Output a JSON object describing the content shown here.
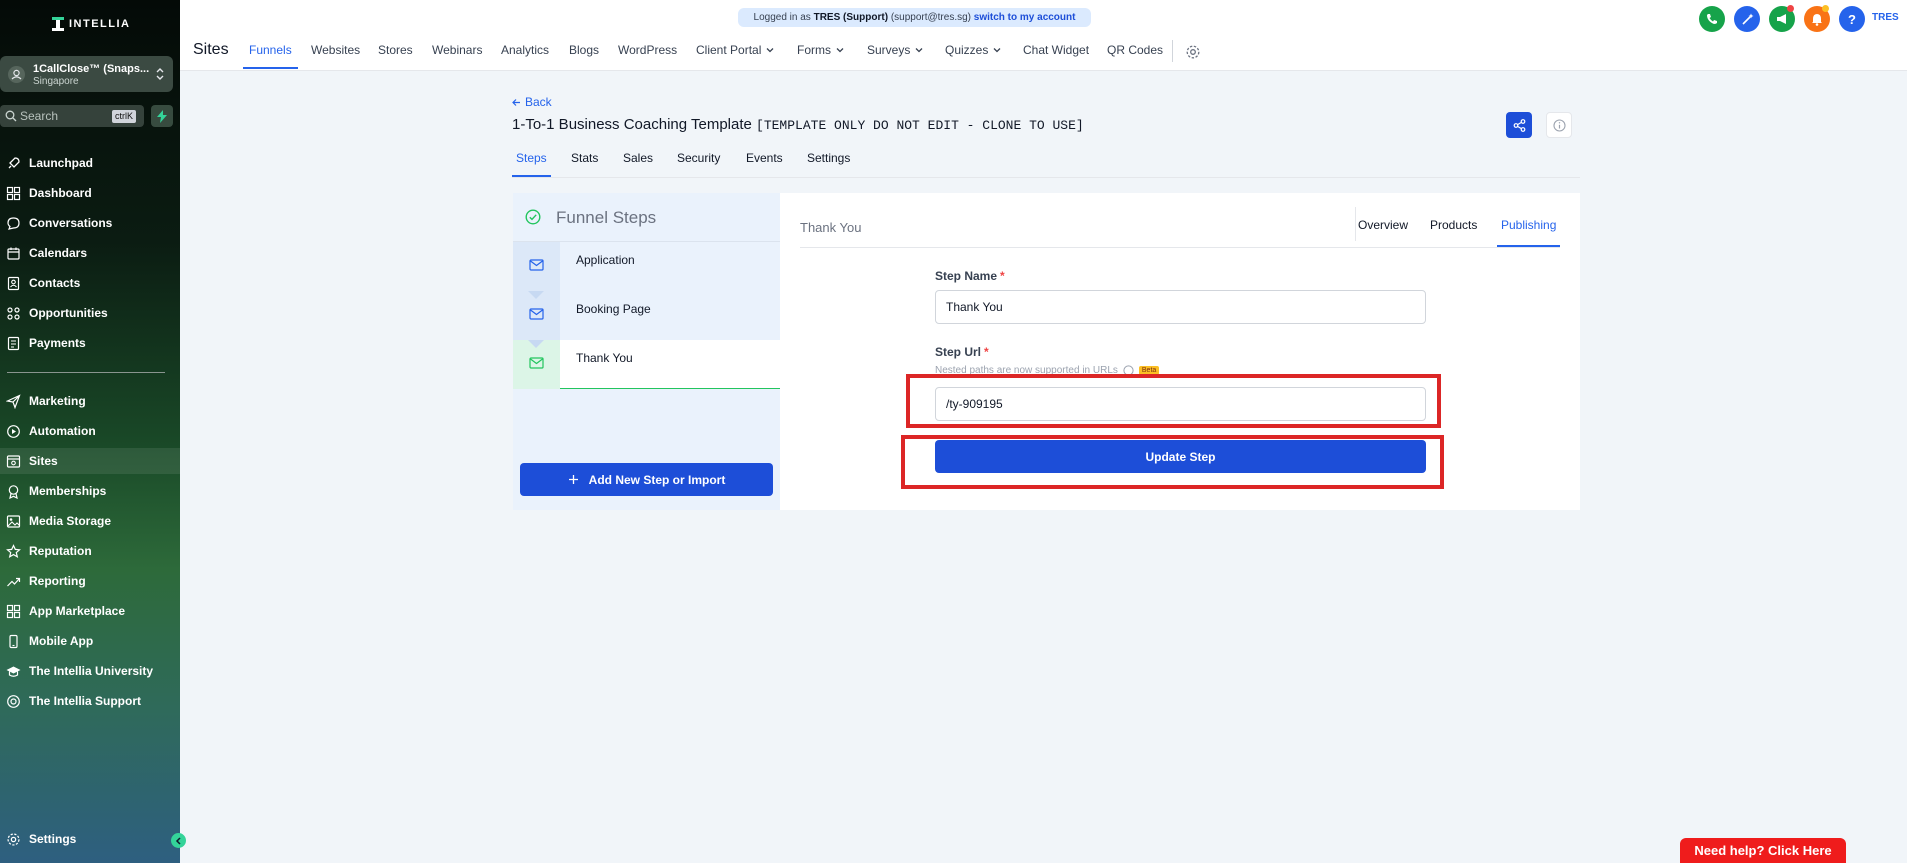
{
  "brand": {
    "name": "INTELLIA"
  },
  "account": {
    "name": "1CallClose™ (Snaps...",
    "location": "Singapore"
  },
  "search": {
    "placeholder": "Search",
    "shortcut": "ctrlK"
  },
  "sidebar": {
    "items": [
      {
        "label": "Launchpad",
        "icon": "rocket-icon"
      },
      {
        "label": "Dashboard",
        "icon": "grid-icon"
      },
      {
        "label": "Conversations",
        "icon": "chat-icon"
      },
      {
        "label": "Calendars",
        "icon": "calendar-icon"
      },
      {
        "label": "Contacts",
        "icon": "contacts-icon"
      },
      {
        "label": "Opportunities",
        "icon": "opportunities-icon"
      },
      {
        "label": "Payments",
        "icon": "payments-icon"
      },
      {
        "label": "Marketing",
        "icon": "send-icon"
      },
      {
        "label": "Automation",
        "icon": "automation-icon"
      },
      {
        "label": "Sites",
        "icon": "sites-icon",
        "active": true
      },
      {
        "label": "Memberships",
        "icon": "memberships-icon"
      },
      {
        "label": "Media Storage",
        "icon": "image-icon"
      },
      {
        "label": "Reputation",
        "icon": "star-icon"
      },
      {
        "label": "Reporting",
        "icon": "trend-icon"
      },
      {
        "label": "App Marketplace",
        "icon": "apps-icon"
      },
      {
        "label": "Mobile App",
        "icon": "mobile-icon"
      },
      {
        "label": "The Intellia University",
        "icon": "graduation-icon"
      },
      {
        "label": "The Intellia Support",
        "icon": "support-icon"
      }
    ],
    "settings_label": "Settings"
  },
  "banner": {
    "prefix": "Logged in as",
    "user": "TRES (Support)",
    "email": "(support@tres.sg)",
    "switch_label": "switch to my account"
  },
  "header": {
    "title": "Sites",
    "nav": [
      {
        "label": "Funnels",
        "active": true
      },
      {
        "label": "Websites"
      },
      {
        "label": "Stores"
      },
      {
        "label": "Webinars"
      },
      {
        "label": "Analytics"
      },
      {
        "label": "Blogs"
      },
      {
        "label": "WordPress"
      },
      {
        "label": "Client Portal",
        "dropdown": true
      },
      {
        "label": "Forms",
        "dropdown": true
      },
      {
        "label": "Surveys",
        "dropdown": true
      },
      {
        "label": "Quizzes",
        "dropdown": true
      },
      {
        "label": "Chat Widget"
      },
      {
        "label": "QR Codes"
      }
    ],
    "user_initials": "TRES",
    "colors": {
      "phone": "#16a34a",
      "magic": "#2563eb",
      "megaphone": "#16a34a",
      "bell": "#f97316",
      "help": "#2563eb"
    }
  },
  "funnel": {
    "back_label": "Back",
    "title": "1-To-1 Business Coaching Template",
    "title_note": "[TEMPLATE ONLY DO NOT EDIT - CLONE TO USE]",
    "tabs": [
      "Steps",
      "Stats",
      "Sales",
      "Security",
      "Events",
      "Settings"
    ]
  },
  "steps": {
    "header": "Funnel Steps",
    "items": [
      {
        "label": "Application"
      },
      {
        "label": "Booking Page"
      },
      {
        "label": "Thank You",
        "active": true
      }
    ],
    "add_label": "Add New Step or Import"
  },
  "step_detail": {
    "title": "Thank You",
    "tabs": [
      {
        "label": "Overview"
      },
      {
        "label": "Products"
      },
      {
        "label": "Publishing",
        "active": true
      }
    ],
    "name_label": "Step Name",
    "name_value": "Thank You",
    "url_label": "Step Url",
    "url_hint": "Nested paths are now supported in URLs",
    "beta_label": "Beta",
    "url_value": "/ty-909195",
    "update_label": "Update Step"
  },
  "need_help_label": "Need help? Click Here"
}
